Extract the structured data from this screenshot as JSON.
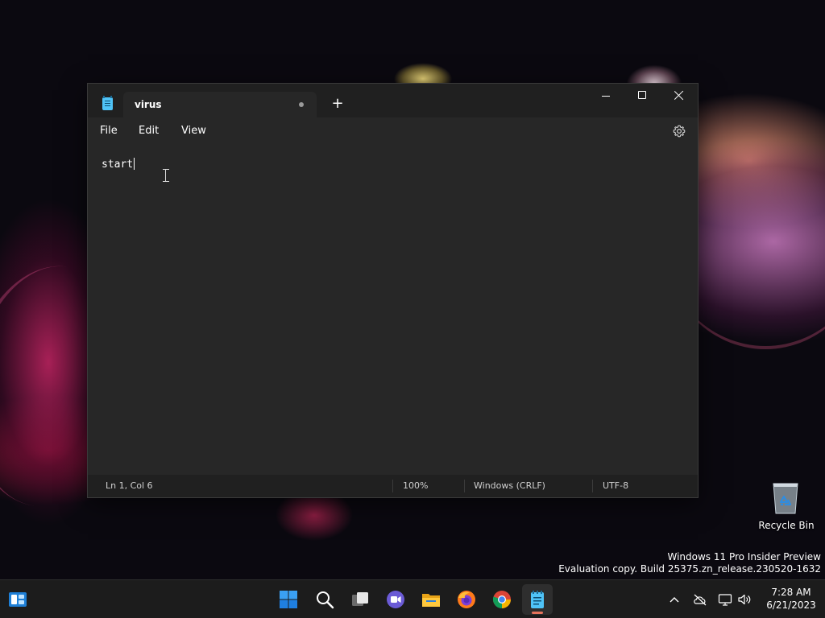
{
  "notepad": {
    "tab_title": "virus",
    "new_tab_label": "+",
    "menu": {
      "file": "File",
      "edit": "Edit",
      "view": "View"
    },
    "editor_text": "start",
    "status": {
      "position": "Ln 1, Col 6",
      "zoom": "100%",
      "line_ending": "Windows (CRLF)",
      "encoding": "UTF-8"
    }
  },
  "desktop": {
    "recycle_bin_label": "Recycle Bin",
    "watermark_line1": "Windows 11 Pro Insider Preview",
    "watermark_line2": "Evaluation copy. Build 25375.zn_release.230520-1632"
  },
  "taskbar": {
    "time": "7:28 AM",
    "date": "6/21/2023",
    "pinned_icons": [
      "widgets-icon",
      "start-icon",
      "search-icon",
      "task-view-icon",
      "teams-icon",
      "file-explorer-icon",
      "firefox-icon",
      "chrome-icon",
      "notepad-icon"
    ],
    "tray_icons": [
      "chevron-up-icon",
      "network-icon",
      "display-icon",
      "volume-icon"
    ]
  },
  "colors": {
    "window_bg": "#272727",
    "titlebar_bg": "#202020",
    "taskbar_bg": "#1c1c1c",
    "accent": "#4fc3f7",
    "active_indicator": "#e6735c"
  }
}
